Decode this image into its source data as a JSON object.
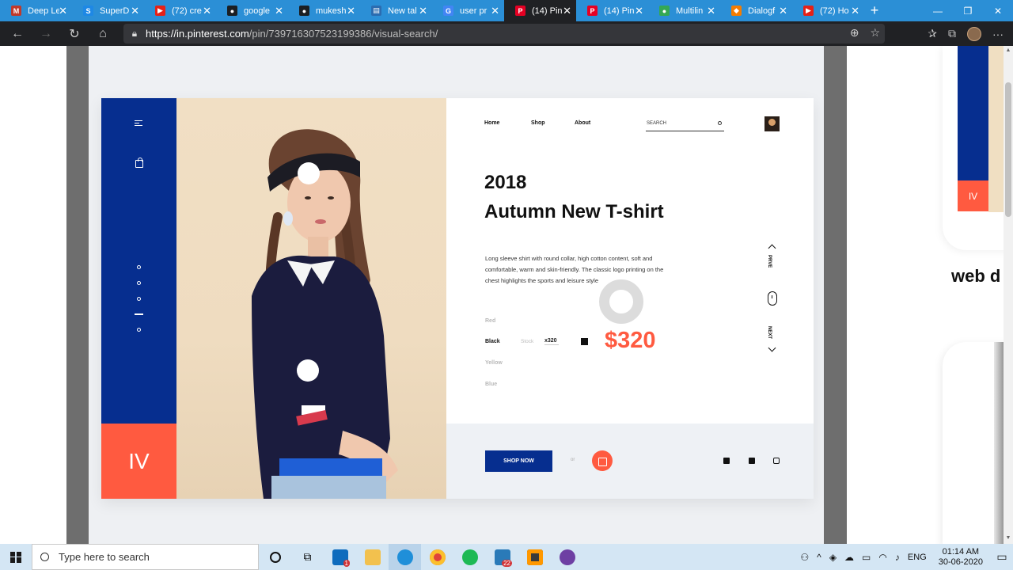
{
  "browser": {
    "tabs": [
      {
        "label": "Deep Le",
        "favicon": "M",
        "color": "#c0392b",
        "active": false
      },
      {
        "label": "SuperD",
        "favicon": "S",
        "color": "#1e88e5",
        "active": false
      },
      {
        "label": "(72) cre",
        "favicon": "▶",
        "color": "#e62117",
        "active": false
      },
      {
        "label": "google",
        "favicon": "●",
        "color": "#1b1f23",
        "active": false
      },
      {
        "label": "mukesh",
        "favicon": "●",
        "color": "#1b1f23",
        "active": false
      },
      {
        "label": "New tal",
        "favicon": "▤",
        "color": "#2b6cb0",
        "active": false
      },
      {
        "label": "user pr",
        "favicon": "G",
        "color": "#4285f4",
        "active": false
      },
      {
        "label": "(14) Pin",
        "favicon": "P",
        "color": "#e60023",
        "active": true
      },
      {
        "label": "(14) Pin",
        "favicon": "P",
        "color": "#e60023",
        "active": false
      },
      {
        "label": "Multilin",
        "favicon": "●",
        "color": "#34a853",
        "active": false
      },
      {
        "label": "Dialogf",
        "favicon": "◆",
        "color": "#f57c00",
        "active": false
      },
      {
        "label": "(72) Ho",
        "favicon": "▶",
        "color": "#e62117",
        "active": false
      }
    ],
    "url_host": "https://in.pinterest.com",
    "url_path": "/pin/739716307523199386/visual-search/"
  },
  "design": {
    "sidebar_number": "IV",
    "nav": {
      "home": "Home",
      "shop": "Shop",
      "about": "About"
    },
    "search_placeholder": "SEARCH",
    "year": "2018",
    "headline": "Autumn New T-shirt",
    "description": "Long sleeve shirt with round collar, high cotton content, soft and comfortable, warm and skin-friendly. The classic logo printing on the chest highlights the sports and leisure style",
    "colors": [
      "Red",
      "Black",
      "Yellow",
      "Blue"
    ],
    "selected_color": "Black",
    "stock_label": "Stock",
    "stock_value": "x320",
    "price": "$320",
    "prev_label": "PRVE",
    "next_label": "NEXT",
    "shop_now": "SHOP NOW",
    "or": "or",
    "accent_blue": "#062e8f",
    "accent_red": "#ff5a40"
  },
  "side_preview": {
    "number": "IV",
    "text": "web d"
  },
  "taskbar": {
    "search_placeholder": "Type here to search",
    "mail_badge": "1",
    "app_badge": "22",
    "language": "ENG",
    "time": "01:14 AM",
    "date": "30-06-2020"
  }
}
